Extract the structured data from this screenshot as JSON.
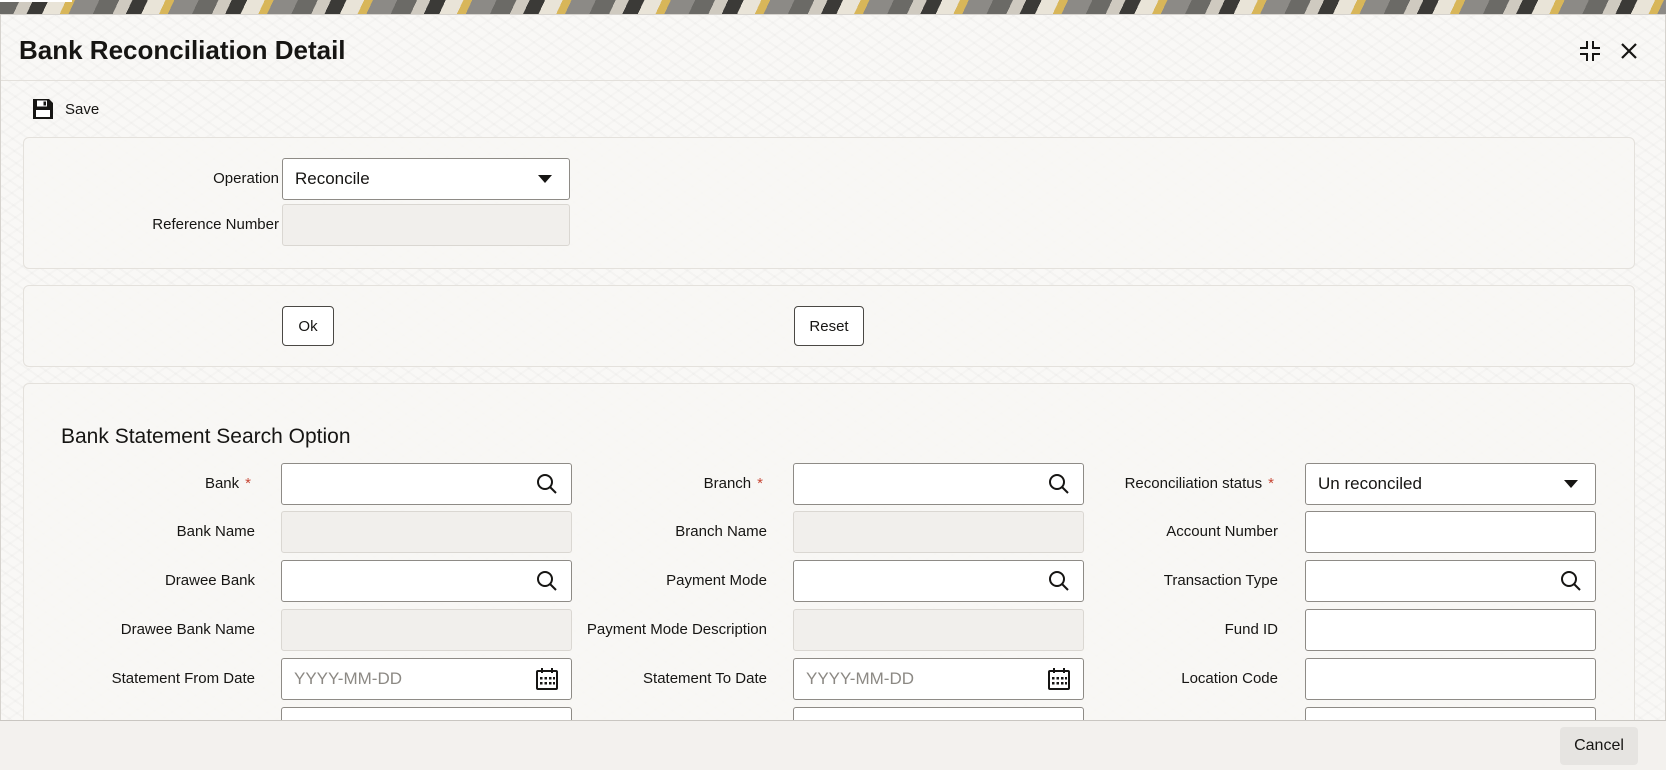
{
  "window": {
    "title": "Bank Reconciliation Detail"
  },
  "header": {
    "maximize_icon": "collapse-arrows-icon",
    "close_icon": "close-icon"
  },
  "toolbar": {
    "save_label": "Save",
    "save_icon": "floppy-disk-icon"
  },
  "operation_panel": {
    "operation": {
      "label": "Operation",
      "value": "Reconcile"
    },
    "reference_number": {
      "label": "Reference Number",
      "value": ""
    }
  },
  "actions": {
    "ok_label": "Ok",
    "reset_label": "Reset"
  },
  "search": {
    "title": "Bank Statement Search Option",
    "bank": {
      "label": "Bank",
      "value": ""
    },
    "branch": {
      "label": "Branch",
      "value": ""
    },
    "reconciliation_status": {
      "label": "Reconciliation status",
      "value": "Un reconciled"
    },
    "bank_name": {
      "label": "Bank Name",
      "value": ""
    },
    "branch_name": {
      "label": "Branch Name",
      "value": ""
    },
    "account_number": {
      "label": "Account Number",
      "value": ""
    },
    "drawee_bank": {
      "label": "Drawee Bank",
      "value": ""
    },
    "payment_mode": {
      "label": "Payment Mode",
      "value": ""
    },
    "transaction_type": {
      "label": "Transaction Type",
      "value": ""
    },
    "drawee_bank_name": {
      "label": "Drawee Bank Name",
      "value": ""
    },
    "payment_mode_description": {
      "label": "Payment Mode Description",
      "value": ""
    },
    "fund_id": {
      "label": "Fund ID",
      "value": ""
    },
    "statement_from_date": {
      "label": "Statement From Date",
      "placeholder": "YYYY-MM-DD"
    },
    "statement_to_date": {
      "label": "Statement To Date",
      "placeholder": "YYYY-MM-DD"
    },
    "location_code": {
      "label": "Location Code",
      "value": ""
    }
  },
  "footer": {
    "cancel_label": "Cancel"
  },
  "colors": {
    "required": "#c74634",
    "text": "#161513",
    "border": "#8e8b86"
  }
}
